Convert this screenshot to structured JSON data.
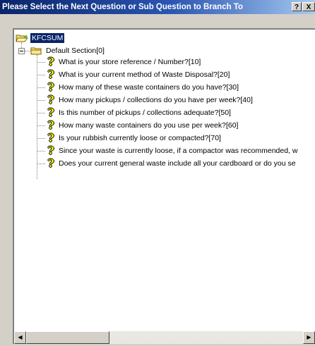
{
  "window": {
    "title": "Please Select the Next Question or Sub Question to Branch To",
    "help_label": "?",
    "close_label": "X"
  },
  "tree": {
    "root": {
      "label": "KFCSUM",
      "icon": "open-folder-icon"
    },
    "section": {
      "label": "Default Section[0]",
      "icon": "folder-icon",
      "expander_state": "expanded"
    },
    "questions": [
      {
        "label": "What is your store reference / Number?[10]",
        "icon": "question-mark-icon"
      },
      {
        "label": "What is your current method of Waste Disposal?[20]",
        "icon": "question-mark-icon"
      },
      {
        "label": "How many of these waste containers do you have?[30]",
        "icon": "question-mark-icon"
      },
      {
        "label": "How many pickups / collections do you have per week?[40]",
        "icon": "question-mark-icon"
      },
      {
        "label": "Is this number of pickups / collections adequate?[50]",
        "icon": "question-mark-icon"
      },
      {
        "label": "How many waste containers do you use per week?[60]",
        "icon": "question-mark-icon"
      },
      {
        "label": "Is your rubbish currently loose or compacted?[70]",
        "icon": "question-mark-icon"
      },
      {
        "label": "Since your waste is currently loose, if a compactor was recommended, w",
        "icon": "question-mark-icon"
      },
      {
        "label": "Does your current general waste include all your cardboard or do you se",
        "icon": "question-mark-icon"
      }
    ]
  },
  "scrollbar": {
    "left_arrow": "◀",
    "right_arrow": "▶"
  }
}
